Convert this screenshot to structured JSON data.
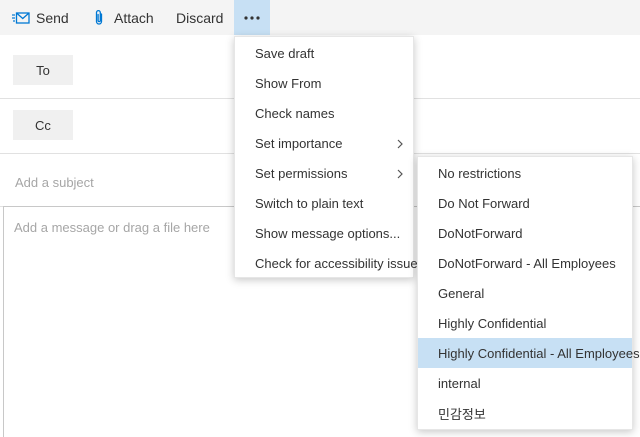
{
  "colors": {
    "accent": "#0078d4",
    "toolbar_bg": "#f4f4f4",
    "highlight": "#c7e0f4"
  },
  "toolbar": {
    "send_label": "Send",
    "attach_label": "Attach",
    "discard_label": "Discard",
    "more_icon": "ellipsis-icon"
  },
  "recipients": {
    "to_label": "To",
    "cc_label": "Cc"
  },
  "subject": {
    "placeholder": "Add a subject"
  },
  "body": {
    "placeholder": "Add a message or drag a file here"
  },
  "more_menu": {
    "items": [
      {
        "label": "Save draft",
        "submenu": false
      },
      {
        "label": "Show From",
        "submenu": false
      },
      {
        "label": "Check names",
        "submenu": false
      },
      {
        "label": "Set importance",
        "submenu": true
      },
      {
        "label": "Set permissions",
        "submenu": true
      },
      {
        "label": "Switch to plain text",
        "submenu": false
      },
      {
        "label": "Show message options...",
        "submenu": false
      },
      {
        "label": "Check for accessibility issues",
        "submenu": false
      }
    ]
  },
  "permissions_menu": {
    "items": [
      {
        "label": "No restrictions"
      },
      {
        "label": "Do Not Forward"
      },
      {
        "label": "DoNotForward"
      },
      {
        "label": "DoNotForward - All Employees"
      },
      {
        "label": "General"
      },
      {
        "label": "Highly Confidential"
      },
      {
        "label": "Highly Confidential - All Employees",
        "highlighted": true
      },
      {
        "label": "internal"
      },
      {
        "label": "민감정보"
      }
    ]
  }
}
